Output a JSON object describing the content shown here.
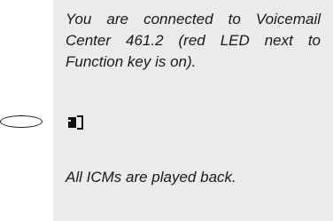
{
  "instruction_note": "You are connected to Voicemail Center 461.2 (red LED next to Function key is on).",
  "result_note": "All ICMs are played back.",
  "icons": {
    "function_key": "oval-key-button-icon",
    "speaker": "speaker-icon"
  }
}
